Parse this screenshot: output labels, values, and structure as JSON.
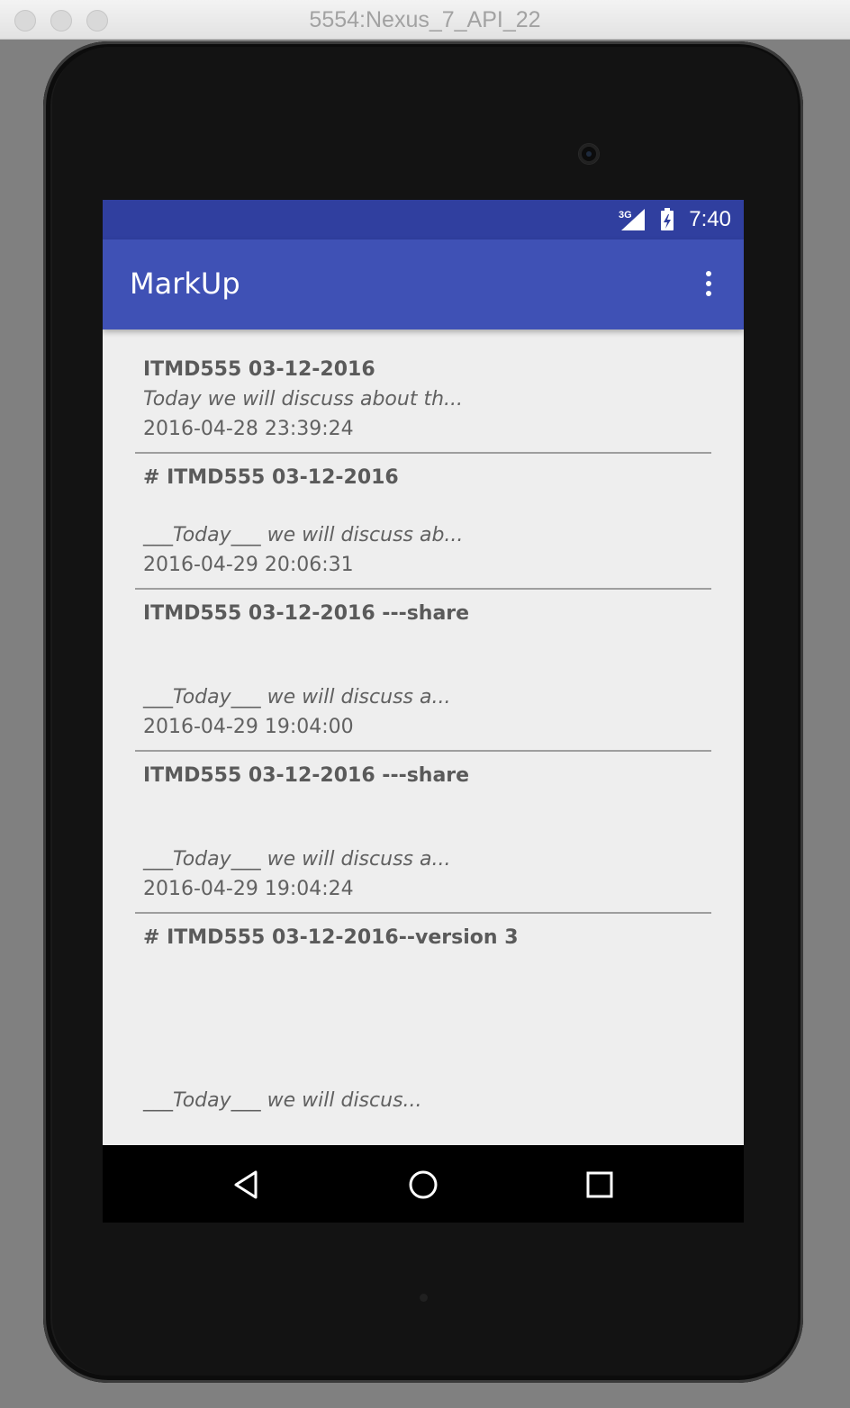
{
  "window": {
    "title": "5554:Nexus_7_API_22"
  },
  "status_bar": {
    "network_label": "3G",
    "time": "7:40",
    "icons": [
      "signal-icon",
      "battery-charging-icon"
    ]
  },
  "app_bar": {
    "title": "MarkUp",
    "overflow_icon": "more-vert-icon"
  },
  "notes": [
    {
      "title": "ITMD555 03-12-2016",
      "body": "Today we will discuss about th...",
      "date": "2016-04-28 23:39:24"
    },
    {
      "title": "# ITMD555 03-12-2016",
      "body": "___Today___ we will discuss ab...",
      "date": "2016-04-29 20:06:31"
    },
    {
      "title": "ITMD555 03-12-2016 ---share",
      "body": "___Today___ we will discuss a...",
      "date": "2016-04-29 19:04:00"
    },
    {
      "title": "ITMD555 03-12-2016 ---share",
      "body": "___Today___ we will discuss a...",
      "date": "2016-04-29 19:04:24"
    },
    {
      "title": "# ITMD555 03-12-2016--version 3",
      "body": "___Today___ we will discus...",
      "date": ""
    }
  ],
  "nav_bar": {
    "back_icon": "back-triangle-icon",
    "home_icon": "home-circle-icon",
    "recents_icon": "recents-square-icon"
  },
  "colors": {
    "status_bar": "#303f9f",
    "app_bar": "#3f51b5",
    "list_background": "#eeeeee",
    "text": "#5a5a5a"
  }
}
